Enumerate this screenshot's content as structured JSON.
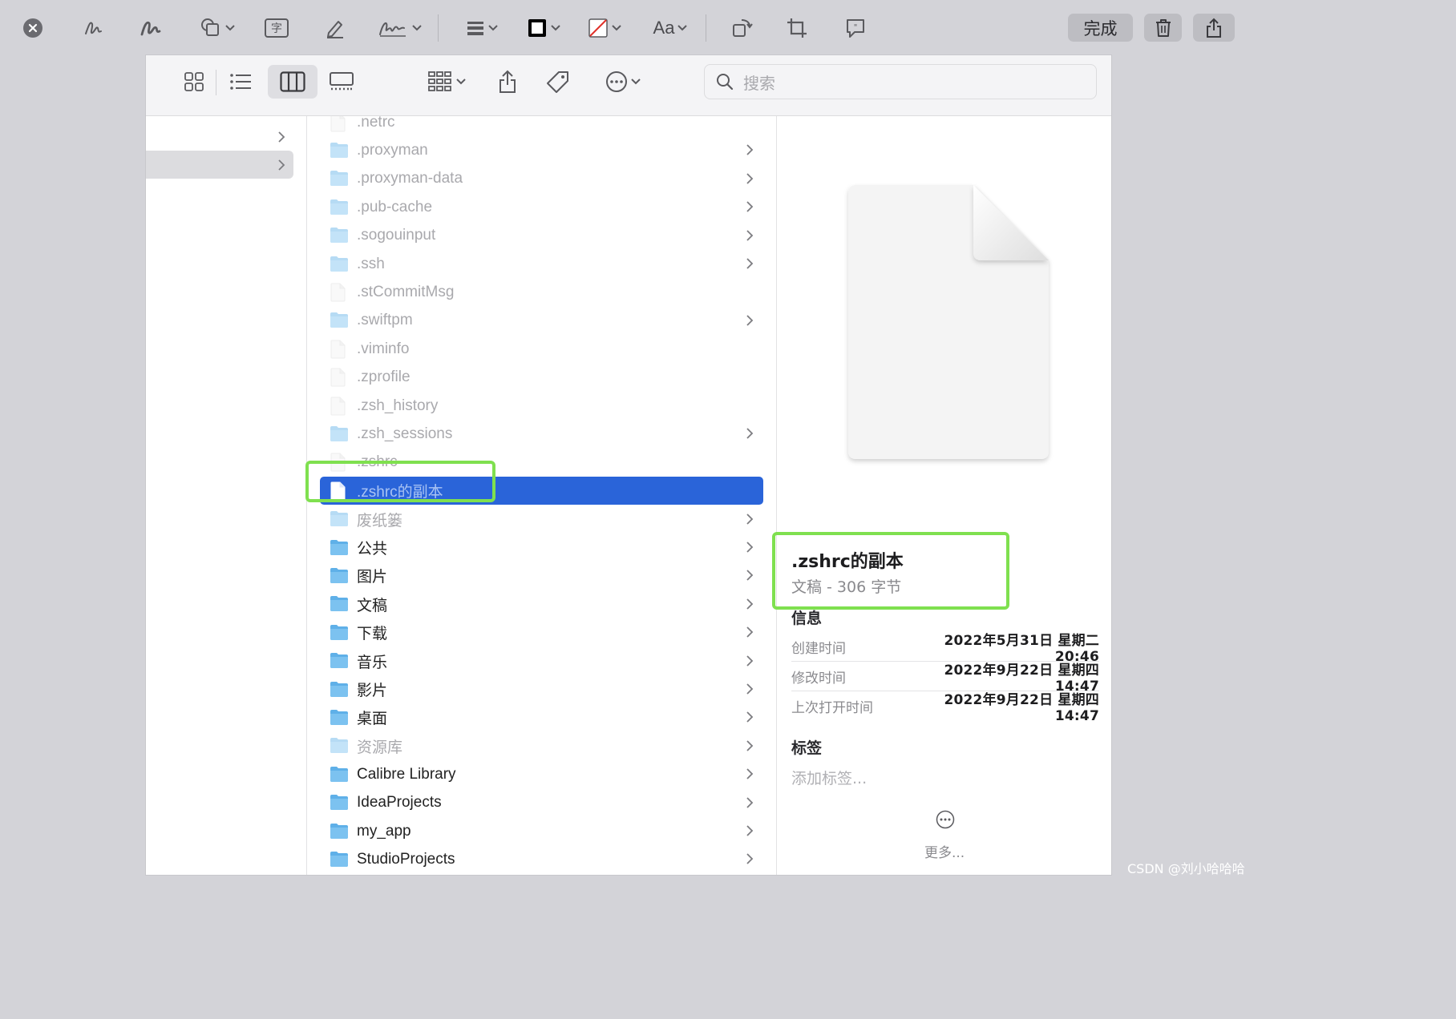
{
  "markup_toolbar": {
    "done_label": "完成",
    "text_box_glyph": "字",
    "font_label": "Aa",
    "icons": [
      "close-icon",
      "sketch-icon",
      "draw-icon",
      "shapes-icon",
      "text-box-icon",
      "highlight-icon",
      "signature-icon",
      "line-style-icon",
      "border-color-icon",
      "fill-color-icon",
      "font-icon",
      "rotate-icon",
      "crop-icon",
      "annotate-icon",
      "trash-icon",
      "share-icon"
    ]
  },
  "finder": {
    "search": {
      "placeholder": "搜索"
    },
    "files": [
      {
        "name": ".netrc",
        "type": "file",
        "hidden": true,
        "has_children": false
      },
      {
        "name": ".proxyman",
        "type": "folder",
        "hidden": true,
        "has_children": true
      },
      {
        "name": ".proxyman-data",
        "type": "folder",
        "hidden": true,
        "has_children": true
      },
      {
        "name": ".pub-cache",
        "type": "folder",
        "hidden": true,
        "has_children": true
      },
      {
        "name": ".sogouinput",
        "type": "folder",
        "hidden": true,
        "has_children": true
      },
      {
        "name": ".ssh",
        "type": "folder",
        "hidden": true,
        "has_children": true
      },
      {
        "name": ".stCommitMsg",
        "type": "file",
        "hidden": true,
        "has_children": false
      },
      {
        "name": ".swiftpm",
        "type": "folder",
        "hidden": true,
        "has_children": true
      },
      {
        "name": ".viminfo",
        "type": "file",
        "hidden": true,
        "has_children": false
      },
      {
        "name": ".zprofile",
        "type": "file",
        "hidden": true,
        "has_children": false
      },
      {
        "name": ".zsh_history",
        "type": "file",
        "hidden": true,
        "has_children": false
      },
      {
        "name": ".zsh_sessions",
        "type": "folder",
        "hidden": true,
        "has_children": true
      },
      {
        "name": ".zshrc",
        "type": "file",
        "hidden": true,
        "has_children": false
      },
      {
        "name": ".zshrc的副本",
        "type": "file",
        "hidden": true,
        "has_children": false,
        "selected": true
      },
      {
        "name": "废纸篓",
        "type": "folder",
        "hidden": true,
        "has_children": true
      },
      {
        "name": "公共",
        "type": "folder",
        "hidden": false,
        "has_children": true
      },
      {
        "name": "图片",
        "type": "folder",
        "hidden": false,
        "has_children": true
      },
      {
        "name": "文稿",
        "type": "folder",
        "hidden": false,
        "has_children": true
      },
      {
        "name": "下载",
        "type": "folder",
        "hidden": false,
        "has_children": true
      },
      {
        "name": "音乐",
        "type": "folder",
        "hidden": false,
        "has_children": true
      },
      {
        "name": "影片",
        "type": "folder",
        "hidden": false,
        "has_children": true
      },
      {
        "name": "桌面",
        "type": "folder",
        "hidden": false,
        "has_children": true
      },
      {
        "name": "资源库",
        "type": "folder",
        "hidden": true,
        "has_children": true
      },
      {
        "name": "Calibre Library",
        "type": "folder",
        "hidden": false,
        "has_children": true
      },
      {
        "name": "IdeaProjects",
        "type": "folder",
        "hidden": false,
        "has_children": true
      },
      {
        "name": "my_app",
        "type": "folder",
        "hidden": false,
        "has_children": true
      },
      {
        "name": "StudioProjects",
        "type": "folder",
        "hidden": false,
        "has_children": true
      }
    ],
    "preview": {
      "name": ".zshrc的副本",
      "kind": "文稿 - 306 字节",
      "info_title": "信息",
      "info": [
        {
          "label": "创建时间",
          "value": "2022年5月31日 星期二 20:46"
        },
        {
          "label": "修改时间",
          "value": "2022年9月22日 星期四 14:47"
        },
        {
          "label": "上次打开时间",
          "value": "2022年9月22日 星期四 14:47"
        }
      ],
      "tags_title": "标签",
      "tags_placeholder": "添加标签...",
      "more_label": "更多..."
    }
  },
  "colors": {
    "selection": "#2a64d9",
    "highlight_box": "#7fe04f",
    "folder": "#5fb0e8"
  },
  "watermark": "CSDN @刘小哈哈哈"
}
